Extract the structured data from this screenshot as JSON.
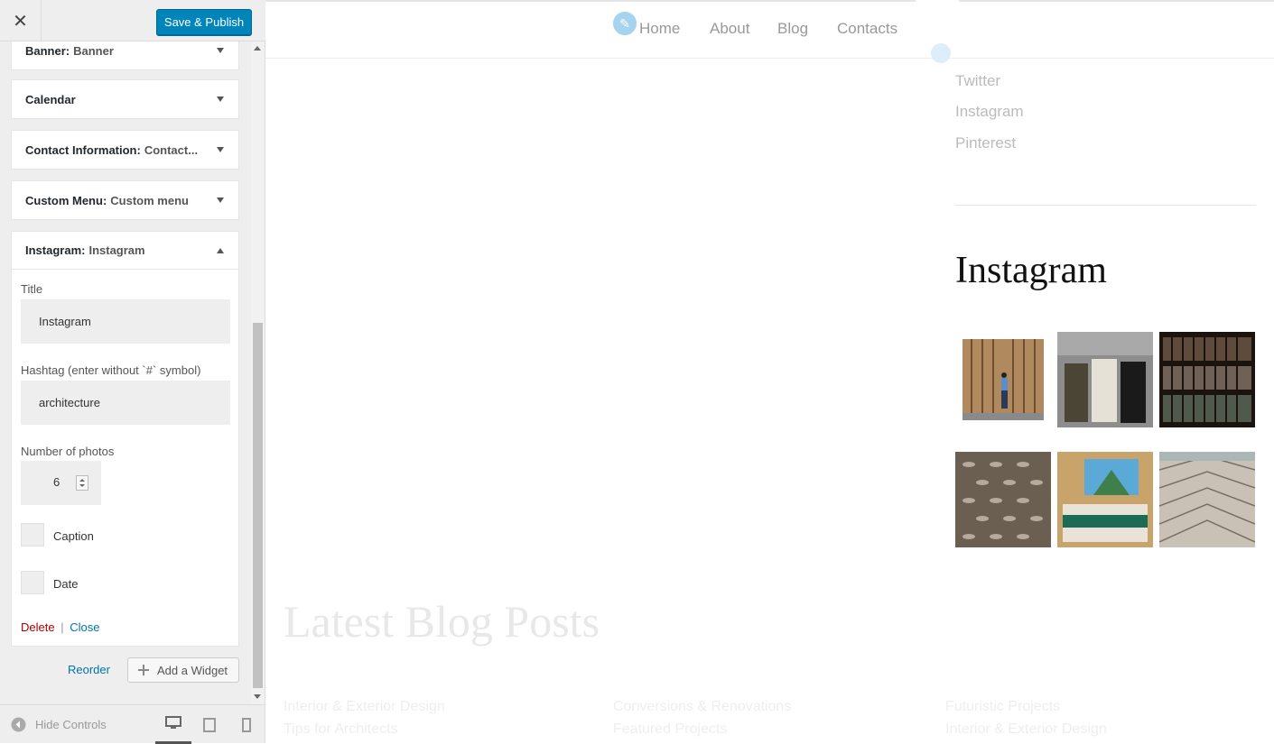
{
  "topbar": {
    "close_glyph": "✕",
    "save_label": "Save & Publish"
  },
  "widgets": [
    {
      "title": "Banner:",
      "subtitle": "Banner"
    },
    {
      "title": "Calendar",
      "subtitle": ""
    },
    {
      "title": "Contact Information:",
      "subtitle": "Contact..."
    },
    {
      "title": "Custom Menu:",
      "subtitle": "Custom menu"
    },
    {
      "title": "Instagram:",
      "subtitle": "Instagram"
    }
  ],
  "instagram_form": {
    "title_label": "Title",
    "title_value": "Instagram",
    "hashtag_label": "Hashtag (enter without `#` symbol)",
    "hashtag_value": "architecture",
    "photos_label": "Number of photos",
    "photos_value": "6",
    "caption_label": "Caption",
    "date_label": "Date",
    "delete_label": "Delete",
    "separator": "|",
    "close_label": "Close"
  },
  "sidebar_footer": {
    "reorder_label": "Reorder",
    "add_widget_label": "Add a Widget"
  },
  "bottombar": {
    "hide_controls_label": "Hide Controls"
  },
  "preview": {
    "nav": [
      "Home",
      "About",
      "Blog",
      "Contacts"
    ],
    "social_links": [
      "Twitter",
      "Instagram",
      "Pinterest"
    ],
    "instagram_heading": "Instagram",
    "latest_heading": "Latest Blog Posts",
    "blog_links": [
      "Interior & Exterior Design",
      "Tips for Architects",
      "Conversions & Renovations",
      "Featured Projects",
      "Futuristic Projects",
      "Interior & Exterior Design"
    ]
  },
  "colors": {
    "accent": "#0085ba",
    "link": "#0073aa",
    "delete": "#a00",
    "panel": "#eeeeee"
  },
  "icons": [
    "close-icon",
    "triangle-down-icon",
    "triangle-up-icon",
    "plus-icon",
    "arrow-left-circle-icon",
    "desktop-icon",
    "tablet-icon",
    "mobile-icon",
    "pencil-icon"
  ]
}
